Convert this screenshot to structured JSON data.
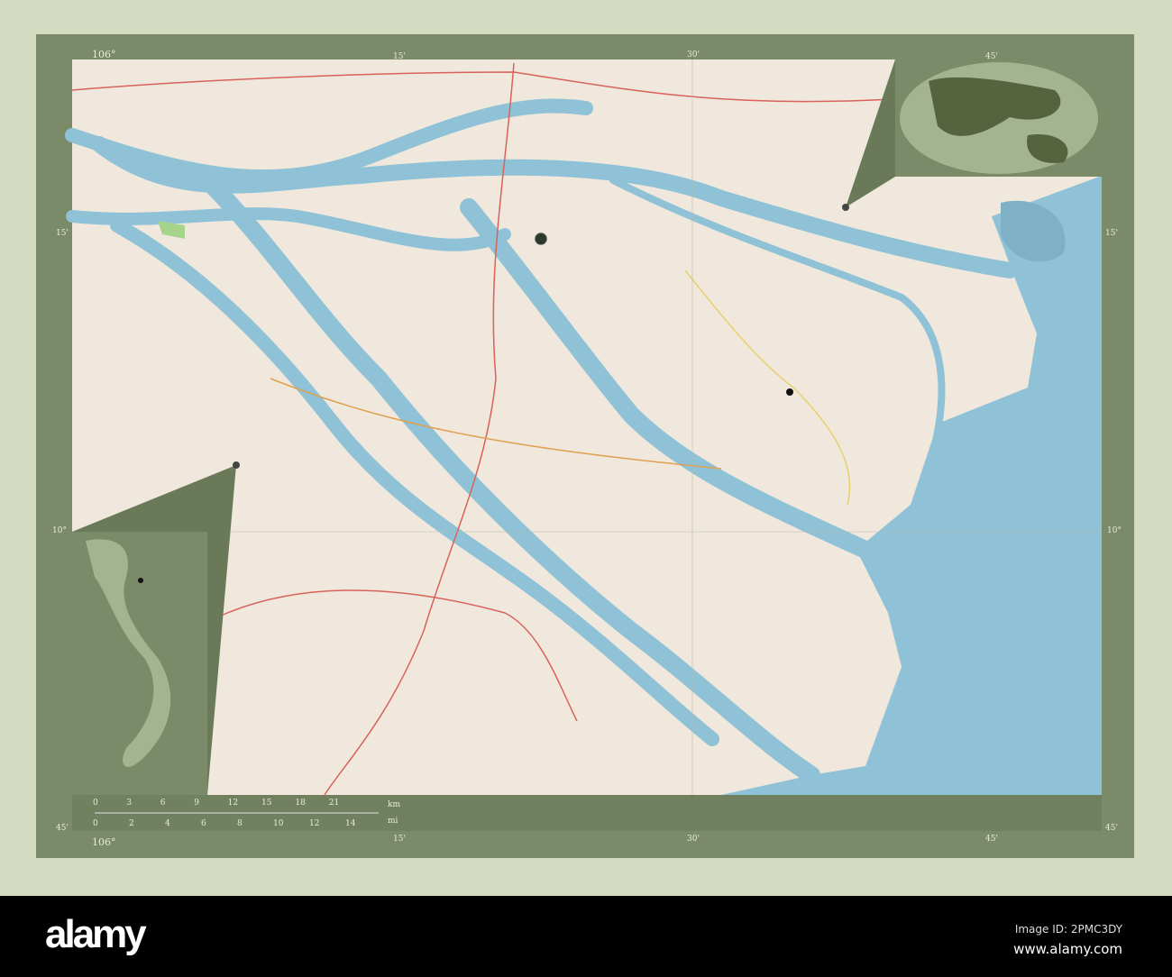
{
  "map": {
    "graticule": {
      "top": [
        "106°",
        "15'",
        "30'",
        "45'"
      ],
      "bottom": [
        "106°",
        "15'",
        "30'",
        "45'"
      ],
      "left": [
        "15'",
        "10°",
        "45'"
      ],
      "right": [
        "15'",
        "10°",
        "45'"
      ]
    },
    "scale_bar": {
      "km_unit": "km",
      "mi_unit": "mi",
      "km_ticks": [
        "0",
        "3",
        "6",
        "9",
        "12",
        "15",
        "18",
        "21"
      ],
      "mi_ticks": [
        "0",
        "2",
        "4",
        "6",
        "8",
        "10",
        "12",
        "14"
      ]
    },
    "colors": {
      "land": "#f0e8dc",
      "river": "#8fc2d6",
      "sea": "#8fc2d6",
      "frame": "#7b8a68",
      "road": "#d9625a"
    },
    "insets": [
      "globe-locator",
      "country-locator"
    ]
  },
  "watermark": {
    "logo": "alamy",
    "image_id": "Image ID: 2PMC3DY",
    "url": "www.alamy.com"
  }
}
